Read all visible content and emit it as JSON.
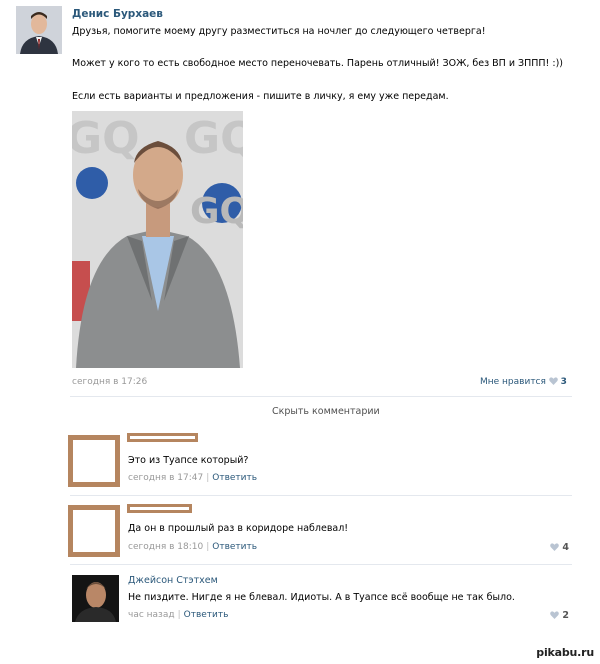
{
  "post": {
    "author": "Денис Бурхаев",
    "lines": [
      "Друзья, помогите моему другу разместиться на ночлег до следующего четверга!",
      "Может у кого то есть свободное место переночевать. Парень отличный! ЗОЖ, без ВП и ЗППП! :))",
      "Если есть варианты и предложения - пишите в личку, я ему уже передам."
    ],
    "photo_text": "GQ",
    "timestamp": "сегодня в 17:26",
    "like_label": "Мне нравится",
    "like_count": "3"
  },
  "hide_comments": "Скрыть комментарии",
  "comments": [
    {
      "text": "Это из Туапсе который?",
      "time": "сегодня в 17:47",
      "reply": "Ответить",
      "likes": ""
    },
    {
      "text": "Да он в прошлый раз в коридоре наблевал!",
      "time": "сегодня в 18:10",
      "reply": "Ответить",
      "likes": "4"
    },
    {
      "name": "Джейсон Стэтхем",
      "text": "Не пиздите. Нигде я не блевал. Идиоты. А в Туапсе всё вообще не так было.",
      "time": "час назад",
      "reply": "Ответить",
      "likes": "2"
    }
  ],
  "watermark": "pikabu.ru",
  "colors": {
    "link": "#2b587a",
    "meta": "#999999",
    "redaction_frame": "#b5855f",
    "like_icon_inactive": "#b9c4d2"
  }
}
